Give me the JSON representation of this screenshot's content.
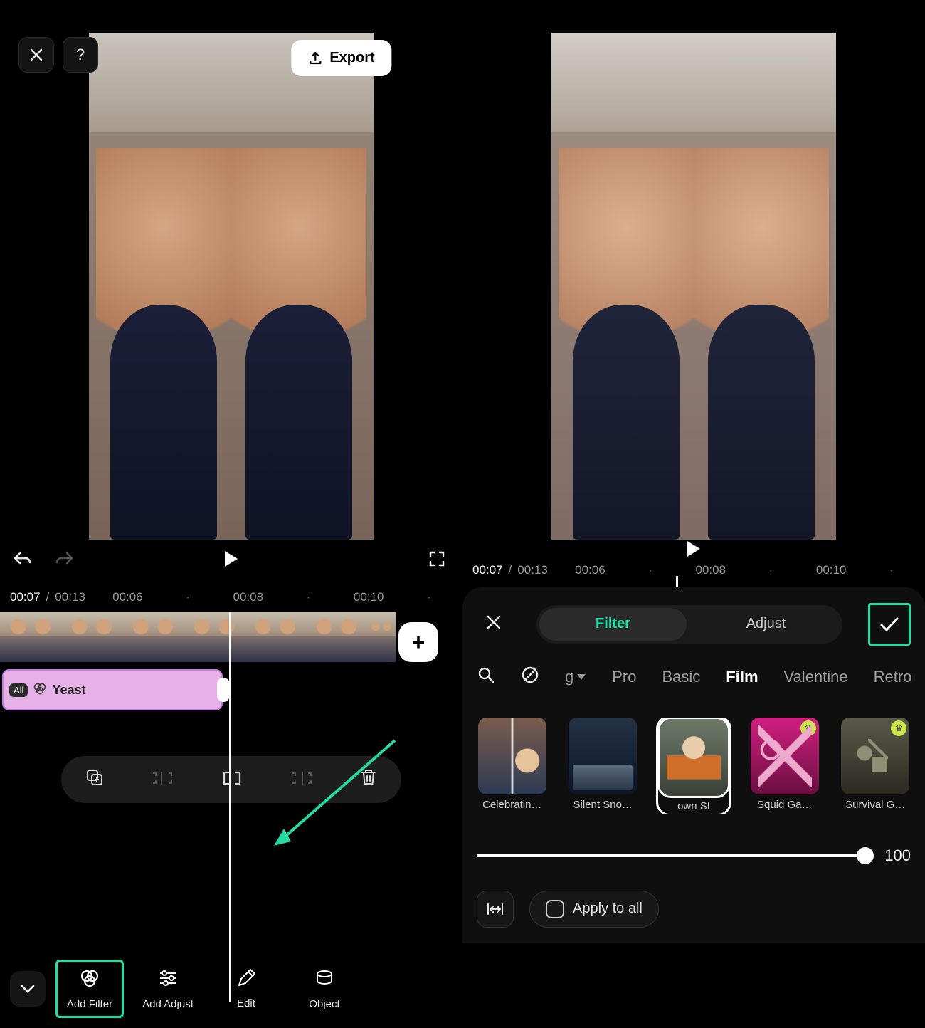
{
  "header": {
    "export_label": "Export"
  },
  "time": {
    "current": "00:07",
    "total": "00:13",
    "sep": " / ",
    "ticks": [
      "00:06",
      "00:08",
      "00:10"
    ]
  },
  "effect_chip": {
    "pill": "All",
    "label": "Yeast"
  },
  "bottom_nav": {
    "items": [
      {
        "label": "Add Filter"
      },
      {
        "label": "Add Adjust"
      },
      {
        "label": "Edit"
      },
      {
        "label": "Object"
      }
    ]
  },
  "filter_panel": {
    "tabs": {
      "filter": "Filter",
      "adjust": "Adjust"
    },
    "dropdown_fragment": "g",
    "categories": [
      "Pro",
      "Basic",
      "Film",
      "Valentine",
      "Retro"
    ],
    "selected_category": "Film",
    "thumbs": [
      {
        "label": "Celebratin…",
        "premium": false
      },
      {
        "label": "Silent Sno…",
        "premium": false
      },
      {
        "label": "own    St",
        "premium": false
      },
      {
        "label": "Squid Ga…",
        "premium": true
      },
      {
        "label": "Survival G…",
        "premium": true
      }
    ],
    "slider_value": "100",
    "slider_pct": 100,
    "apply_all_label": "Apply to all"
  }
}
